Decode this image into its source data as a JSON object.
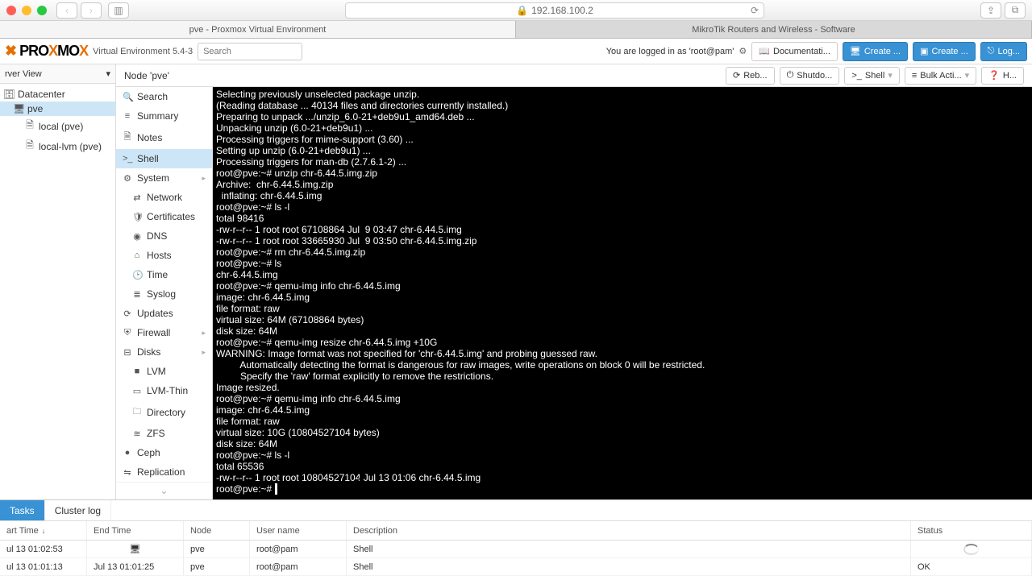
{
  "browser": {
    "url_host": "192.168.100.2",
    "tabs": [
      "pve - Proxmox Virtual Environment",
      "MikroTik Routers and Wireless - Software"
    ]
  },
  "header": {
    "logo_a": "PRO",
    "logo_b": "X",
    "logo_c": "MO",
    "logo_d": "X",
    "subtitle": "Virtual Environment 5.4-3",
    "search_placeholder": "Search",
    "login_text": "You are logged in as 'root@pam'",
    "doc": "Documentati...",
    "create1": "Create ...",
    "create2": "Create ...",
    "logout": "Log..."
  },
  "tree": {
    "view": "rver View",
    "items": [
      {
        "label": "Datacenter",
        "icon": "🗄",
        "lvl": 1
      },
      {
        "label": "pve",
        "icon": "🖥",
        "lvl": 2,
        "sel": true
      },
      {
        "label": "local (pve)",
        "icon": "🗎",
        "lvl": 3
      },
      {
        "label": "local-lvm (pve)",
        "icon": "🗎",
        "lvl": 3
      }
    ]
  },
  "crumb": {
    "title": "Node 'pve'",
    "buttons": [
      "Reb...",
      "Shutdo...",
      "Shell",
      "Bulk Acti...",
      "H..."
    ],
    "icons": [
      "⟳",
      "⏻",
      ">_",
      "≡",
      "❓"
    ]
  },
  "submenu": [
    {
      "ic": "🔍",
      "label": "Search"
    },
    {
      "ic": "≡",
      "label": "Summary"
    },
    {
      "ic": "🗎",
      "label": "Notes"
    },
    {
      "ic": ">_",
      "label": "Shell",
      "sel": true
    },
    {
      "ic": "⚙",
      "label": "System",
      "arrow": true
    },
    {
      "ic": "⇄",
      "label": "Network",
      "sub": true
    },
    {
      "ic": "🛡",
      "label": "Certificates",
      "sub": true
    },
    {
      "ic": "◉",
      "label": "DNS",
      "sub": true
    },
    {
      "ic": "⌂",
      "label": "Hosts",
      "sub": true
    },
    {
      "ic": "🕑",
      "label": "Time",
      "sub": true
    },
    {
      "ic": "≣",
      "label": "Syslog",
      "sub": true
    },
    {
      "ic": "⟳",
      "label": "Updates"
    },
    {
      "ic": "⛨",
      "label": "Firewall",
      "arrow": true
    },
    {
      "ic": "⊟",
      "label": "Disks",
      "arrow": true
    },
    {
      "ic": "■",
      "label": "LVM",
      "sub": true
    },
    {
      "ic": "▭",
      "label": "LVM-Thin",
      "sub": true
    },
    {
      "ic": "🗀",
      "label": "Directory",
      "sub": true
    },
    {
      "ic": "≋",
      "label": "ZFS",
      "sub": true
    },
    {
      "ic": "●",
      "label": "Ceph"
    },
    {
      "ic": "⇋",
      "label": "Replication"
    }
  ],
  "terminal": "Selecting previously unselected package unzip.\n(Reading database ... 40134 files and directories currently installed.)\nPreparing to unpack .../unzip_6.0-21+deb9u1_amd64.deb ...\nUnpacking unzip (6.0-21+deb9u1) ...\nProcessing triggers for mime-support (3.60) ...\nSetting up unzip (6.0-21+deb9u1) ...\nProcessing triggers for man-db (2.7.6.1-2) ...\nroot@pve:~# unzip chr-6.44.5.img.zip\nArchive:  chr-6.44.5.img.zip\n  inflating: chr-6.44.5.img\nroot@pve:~# ls -l\ntotal 98416\n-rw-r--r-- 1 root root 67108864 Jul  9 03:47 chr-6.44.5.img\n-rw-r--r-- 1 root root 33665930 Jul  9 03:50 chr-6.44.5.img.zip\nroot@pve:~# rm chr-6.44.5.img.zip\nroot@pve:~# ls\nchr-6.44.5.img\nroot@pve:~# qemu-img info chr-6.44.5.img\nimage: chr-6.44.5.img\nfile format: raw\nvirtual size: 64M (67108864 bytes)\ndisk size: 64M\nroot@pve:~# qemu-img resize chr-6.44.5.img +10G\nWARNING: Image format was not specified for 'chr-6.44.5.img' and probing guessed raw.\n         Automatically detecting the format is dangerous for raw images, write operations on block 0 will be restricted.\n         Specify the 'raw' format explicitly to remove the restrictions.\nImage resized.\nroot@pve:~# qemu-img info chr-6.44.5.img\nimage: chr-6.44.5.img\nfile format: raw\nvirtual size: 10G (10804527104 bytes)\ndisk size: 64M\nroot@pve:~# ls -l\ntotal 65536\n-rw-r--r-- 1 root root 10804527104 Jul 13 01:06 chr-6.44.5.img\nroot@pve:~# ",
  "bottom": {
    "tabs": [
      "Tasks",
      "Cluster log"
    ],
    "cols": {
      "start": "art Time",
      "end": "End Time",
      "node": "Node",
      "user": "User name",
      "desc": "Description",
      "status": "Status"
    },
    "rows": [
      {
        "start": "ul 13 01:02:53",
        "end_icon": true,
        "end": "",
        "node": "pve",
        "user": "root@pam",
        "desc": "Shell",
        "status": "",
        "spin": true
      },
      {
        "start": "ul 13 01:01:13",
        "end": "Jul 13 01:01:25",
        "node": "pve",
        "user": "root@pam",
        "desc": "Shell",
        "status": "OK"
      }
    ]
  }
}
